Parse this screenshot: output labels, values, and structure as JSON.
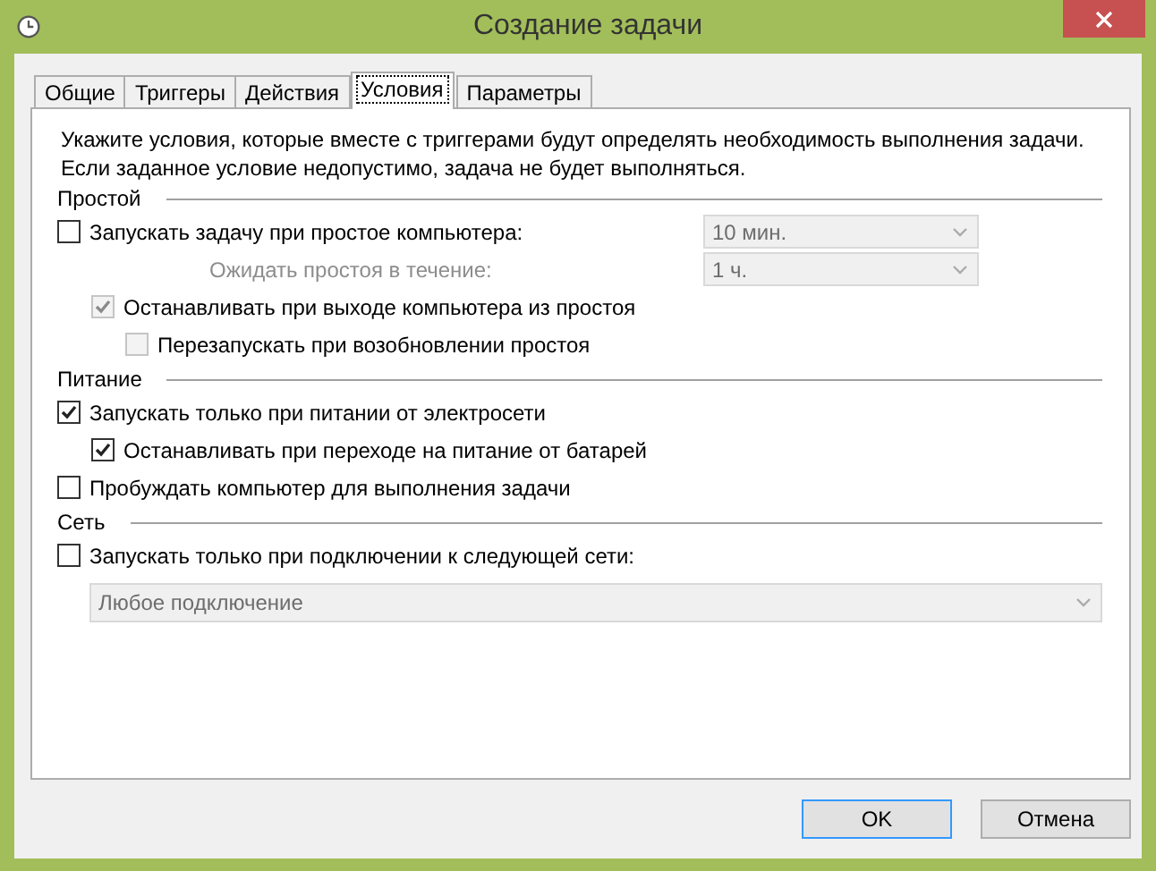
{
  "window": {
    "title": "Создание задачи"
  },
  "tabs": [
    {
      "label": "Общие",
      "selected": false
    },
    {
      "label": "Триггеры",
      "selected": false
    },
    {
      "label": "Действия",
      "selected": false
    },
    {
      "label": "Условия",
      "selected": true
    },
    {
      "label": "Параметры",
      "selected": false
    }
  ],
  "intro": [
    "Укажите условия, которые вместе с триггерами будут определять необходимость выполнения задачи.",
    "Если заданное условие недопустимо, задача не будет выполняться."
  ],
  "sections": [
    {
      "title": "Простой",
      "rows": [
        {
          "kind": "checkbox",
          "label": "Запускать задачу при простое компьютера:",
          "checked": false,
          "disabled": false,
          "dropdown": {
            "value": "10 мин.",
            "disabled": true
          },
          "children": [
            {
              "kind": "labeled-dropdown",
              "label": "Ожидать простоя в течение:",
              "disabled": true,
              "dropdown": {
                "value": "1 ч.",
                "disabled": true
              }
            },
            {
              "kind": "checkbox",
              "label": "Останавливать при выходе компьютера из простоя",
              "checked": true,
              "disabled": true,
              "children": [
                {
                  "kind": "checkbox",
                  "label": "Перезапускать при возобновлении простоя",
                  "checked": false,
                  "disabled": true
                }
              ]
            }
          ]
        }
      ]
    },
    {
      "title": "Питание",
      "rows": [
        {
          "kind": "checkbox",
          "label": "Запускать только при питании от электросети",
          "checked": true,
          "disabled": false,
          "children": [
            {
              "kind": "checkbox",
              "label": "Останавливать при переходе на питание от батарей",
              "checked": true,
              "disabled": false
            }
          ]
        },
        {
          "kind": "checkbox",
          "label": "Пробуждать компьютер для выполнения задачи",
          "checked": false,
          "disabled": false
        }
      ]
    },
    {
      "title": "Сеть",
      "rows": [
        {
          "kind": "checkbox",
          "label": "Запускать только при подключении к следующей сети:",
          "checked": false,
          "disabled": false,
          "children": [
            {
              "kind": "wide-dropdown",
              "dropdown": {
                "value": "Любое подключение",
                "disabled": true
              }
            }
          ]
        }
      ]
    }
  ],
  "buttons": [
    {
      "label": "OK",
      "default": true
    },
    {
      "label": "Отмена",
      "default": false
    }
  ]
}
